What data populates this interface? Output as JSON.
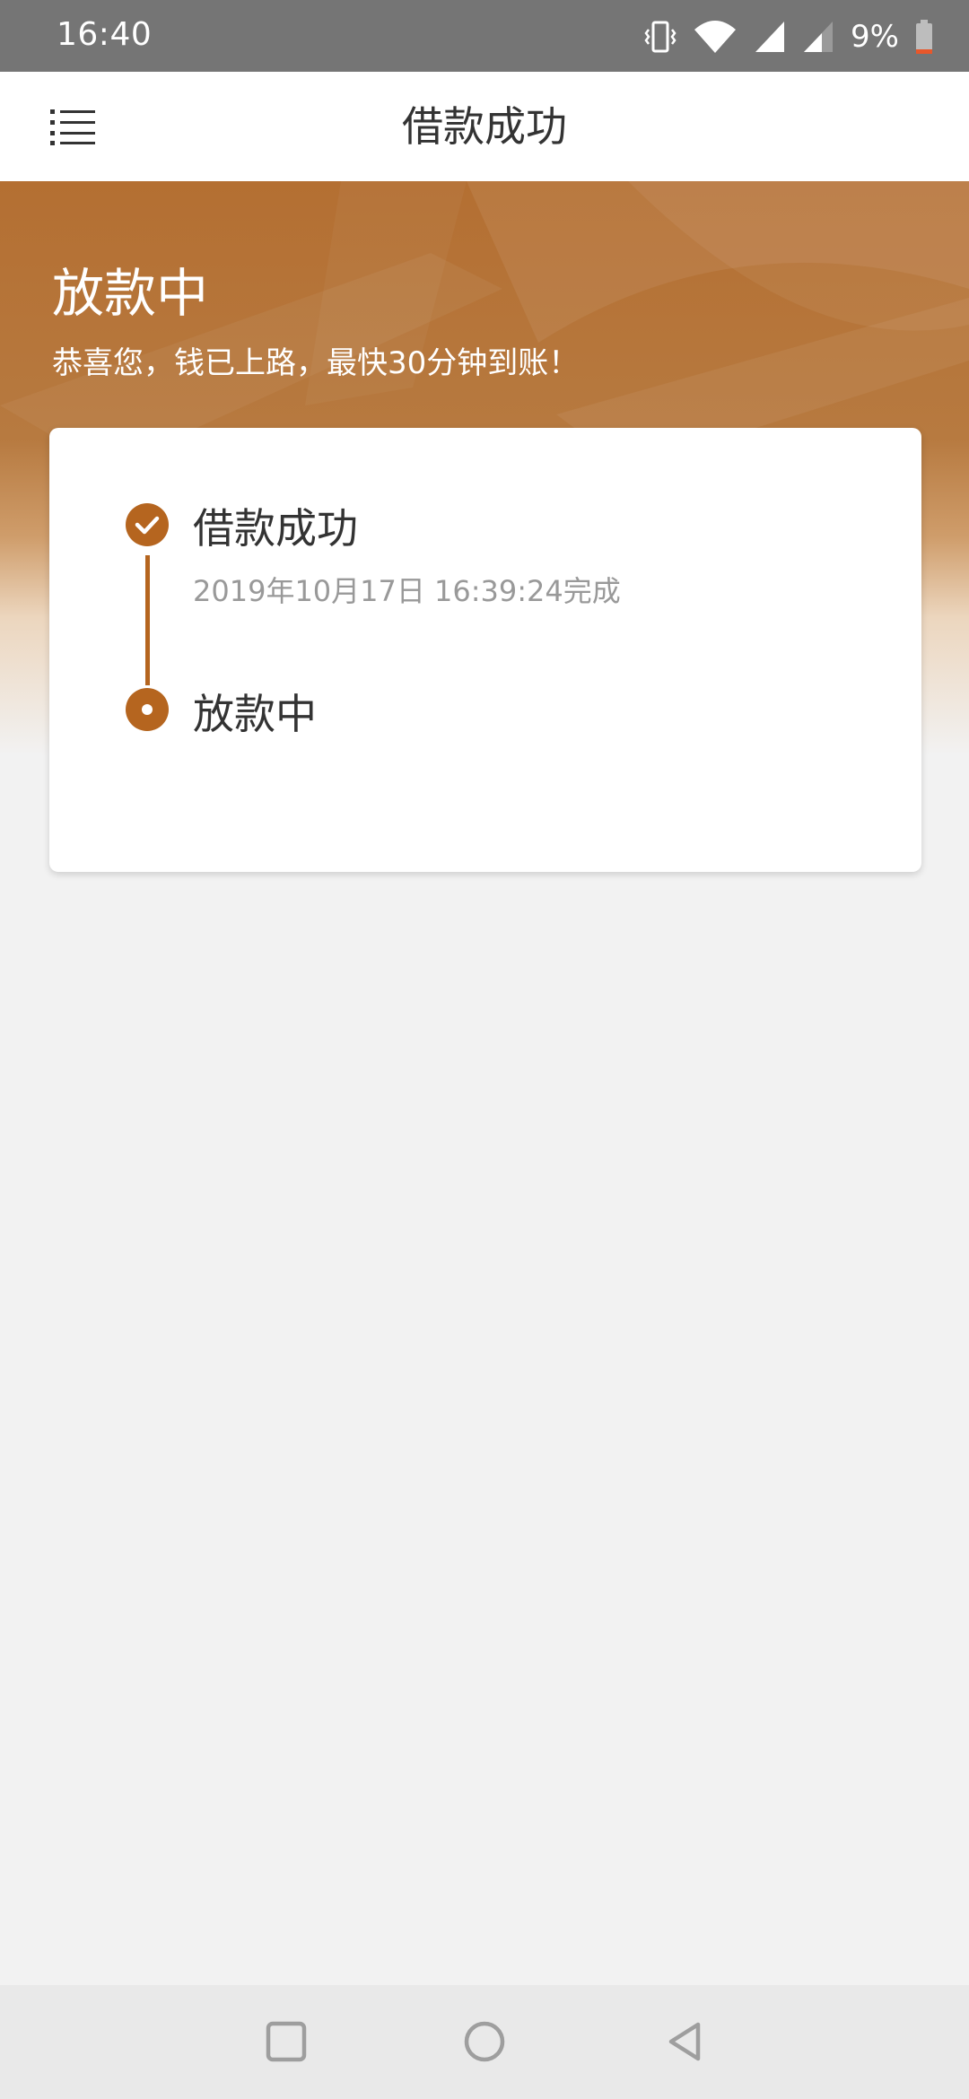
{
  "status_bar": {
    "time": "16:40",
    "battery_text": "9%",
    "icons": [
      "vibrate-icon",
      "wifi-icon",
      "signal-icon",
      "signal-icon-2",
      "battery-icon"
    ]
  },
  "header": {
    "title": "借款成功",
    "menu_icon": "menu-icon"
  },
  "hero": {
    "title": "放款中",
    "subtitle": "恭喜您，钱已上路，最快30分钟到账！"
  },
  "timeline": {
    "steps": [
      {
        "title": "借款成功",
        "time": "2019年10月17日 16:39:24完成",
        "icon": "check-circle-icon"
      },
      {
        "title": "放款中",
        "icon": "dot-circle-icon"
      }
    ]
  },
  "colors": {
    "accent": "#b5651f",
    "hero": "#b46f32",
    "background": "#f2f2f2",
    "status_bar": "#757575"
  },
  "nav_bar": {
    "icons": [
      "recents-square-icon",
      "home-circle-icon",
      "back-triangle-icon"
    ]
  }
}
